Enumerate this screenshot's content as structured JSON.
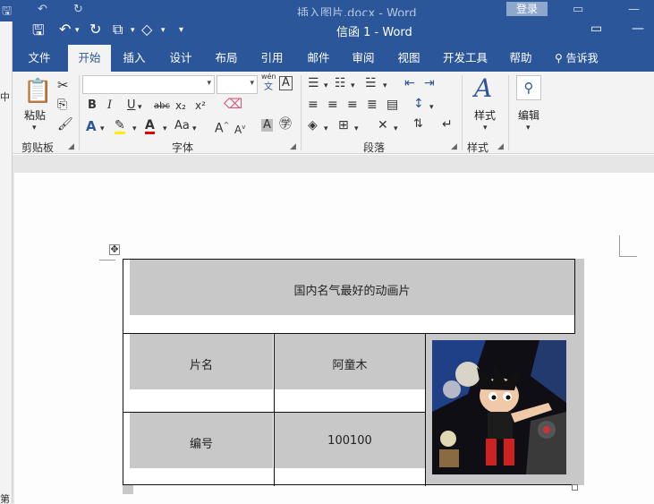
{
  "background_window": {
    "title": "插入图片.docx  -  Word",
    "login": "登录",
    "left_chars": [
      "中",
      "第"
    ]
  },
  "window": {
    "doc_title": "信函 1  -  Word"
  },
  "ribbon": {
    "tabs": [
      "文件",
      "开始",
      "插入",
      "设计",
      "布局",
      "引用",
      "邮件",
      "审阅",
      "视图",
      "开发工具",
      "帮助"
    ],
    "active_tab": "开始",
    "tell_me": "告诉我",
    "groups": {
      "clipboard": "剪贴板",
      "font": "字体",
      "paragraph": "段落",
      "styles": "样式"
    },
    "paste_label": "粘贴",
    "styles_label": "样式",
    "edit_label": "编辑",
    "phonetic_top": "wén",
    "phonetic_bottom": "文",
    "font_name": "",
    "font_size": ""
  },
  "table": {
    "header": "国内名气最好的动画片",
    "rows": [
      {
        "label": "片名",
        "value": "阿童木"
      },
      {
        "label": "编号",
        "value": "100100"
      }
    ],
    "image": "astro-boy-picture"
  },
  "colors": {
    "word_blue": "#2b579a",
    "ribbon_bg": "#f3f3f3",
    "cell_shade": "#c8c8c8"
  }
}
